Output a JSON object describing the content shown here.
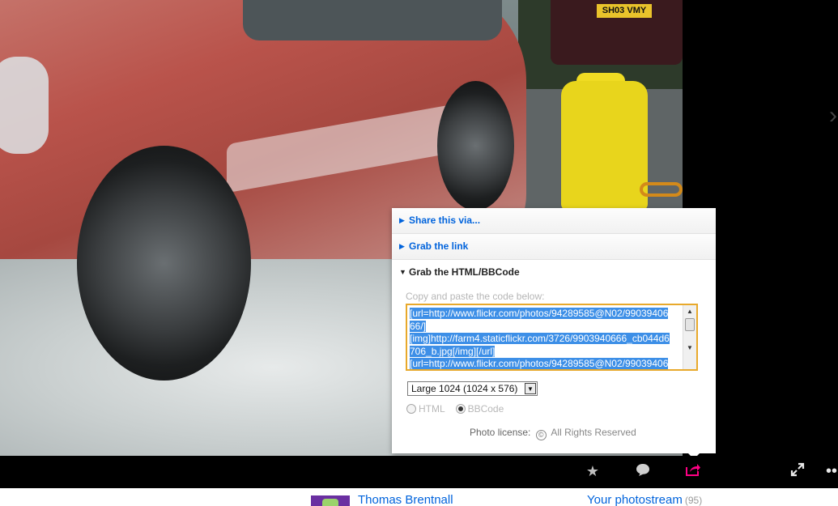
{
  "photo": {
    "license_plate": "SH03 VMY"
  },
  "share_panel": {
    "rows": [
      {
        "label": "Share this via...",
        "state": "collapsed"
      },
      {
        "label": "Grab the link",
        "state": "collapsed"
      },
      {
        "label": "Grab the HTML/BBCode",
        "state": "expanded"
      }
    ],
    "copy_hint": "Copy and paste the code below:",
    "code_lines": [
      "[url=http://www.flickr.com/photos/94289585@N02/99039406",
      "66/]",
      "[img]http://farm4.staticflickr.com/3726/9903940666_cb044d6",
      "706_b.jpg[/img][/url]",
      "[url=http://www.flickr.com/photos/94289585@N02/99039406"
    ],
    "size_select": "Large 1024 (1024 x 576)",
    "format_options": [
      "HTML",
      "BBCode"
    ],
    "format_selected": "BBCode",
    "license_label": "Photo license:",
    "license_symbol": "©",
    "license_value": "All Rights Reserved"
  },
  "toolbar": {
    "icons": [
      "star-icon",
      "comment-icon",
      "share-icon",
      "fullscreen-icon",
      "more-icon"
    ],
    "share_active_color": "#ff0084"
  },
  "footer": {
    "owner_name": "Thomas Brentnall",
    "photostream_label": "Your photostream",
    "photostream_count": "(95)"
  }
}
